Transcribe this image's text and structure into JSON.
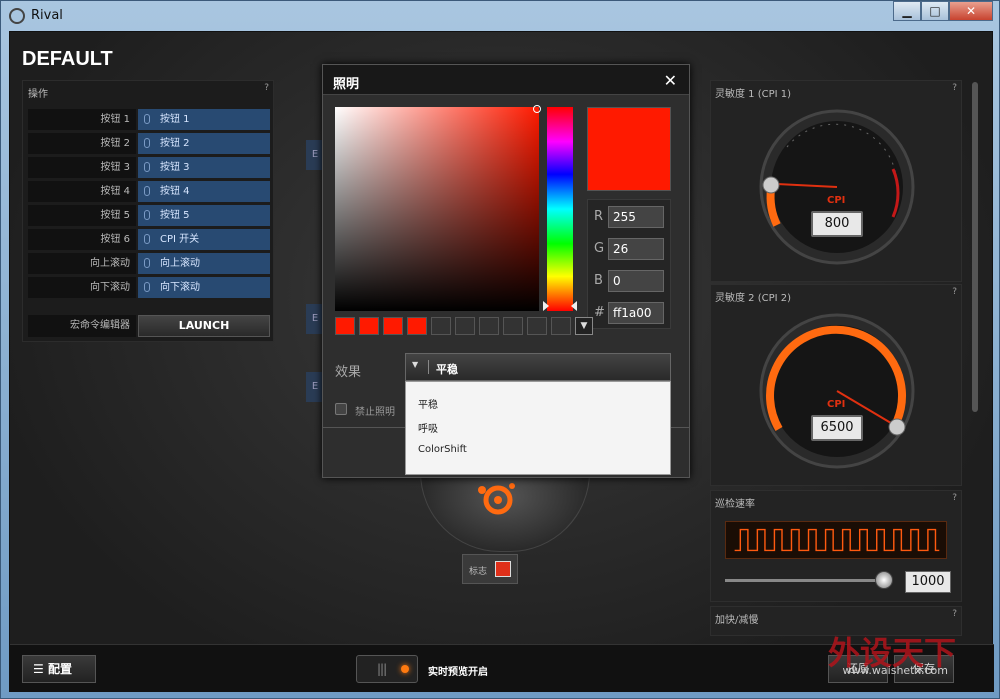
{
  "app": {
    "title": "Rival",
    "profile": "DEFAULT"
  },
  "actions": {
    "title": "操作",
    "help": "?",
    "rows": [
      {
        "label": "按钮 1",
        "value": "按钮 1"
      },
      {
        "label": "按钮 2",
        "value": "按钮 2"
      },
      {
        "label": "按钮 3",
        "value": "按钮 3"
      },
      {
        "label": "按钮 4",
        "value": "按钮 4"
      },
      {
        "label": "按钮 5",
        "value": "按钮 5"
      },
      {
        "label": "按钮 6",
        "value": "CPI 开关"
      },
      {
        "label": "向上滚动",
        "value": "向上滚动"
      },
      {
        "label": "向下滚动",
        "value": "向下滚动"
      }
    ],
    "macro_label": "宏命令编辑器",
    "launch": "LAUNCH"
  },
  "stub_label": "E",
  "dialog": {
    "title": "照明",
    "close": "✕",
    "color": {
      "r": "255",
      "g": "26",
      "b": "0",
      "hex": "ff1a00",
      "preview": "#ff1a00"
    },
    "labels": {
      "r": "R",
      "g": "G",
      "b": "B",
      "hex": "#"
    },
    "swatches": [
      "#ff1a00",
      "#ff1a00",
      "#ff1a00",
      "#ff1a00",
      "#333333",
      "#333333",
      "#333333",
      "#333333",
      "#333333",
      "#333333"
    ],
    "effect_label": "效果",
    "effect_current": "平稳",
    "effect_options": [
      "平稳",
      "呼吸",
      "ColorShift"
    ],
    "disable_label": "禁止照明"
  },
  "cpi1": {
    "title": "灵敏度 1 (CPI 1)",
    "unit": "CPI",
    "value": "800",
    "help": "?"
  },
  "cpi2": {
    "title": "灵敏度 2 (CPI 2)",
    "unit": "CPI",
    "value": "6500",
    "help": "?"
  },
  "polling": {
    "title": "巡检速率",
    "value": "1000",
    "help": "?"
  },
  "accel": {
    "title": "加快/减慢",
    "help": "?"
  },
  "logo_label": "标志",
  "logo_color": "#e0301a",
  "bottom": {
    "config": "配置",
    "live_preview": "实时预览开启",
    "revert": "还原",
    "save": "保存"
  },
  "watermark": {
    "text": "外设天下",
    "url": "www.waishetx.com"
  }
}
